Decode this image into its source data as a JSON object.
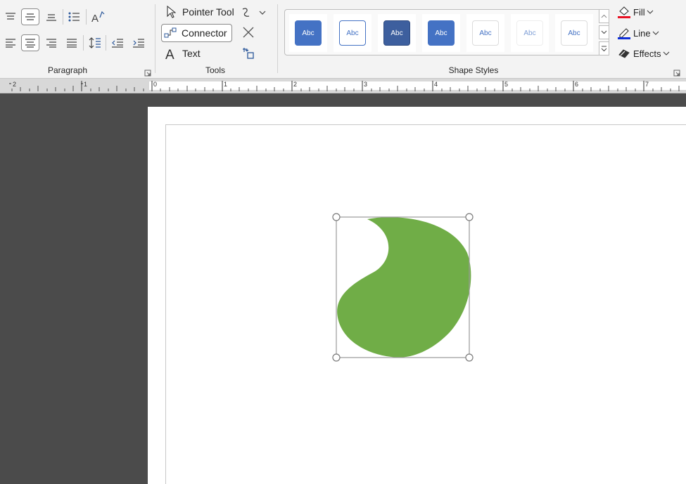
{
  "ribbon": {
    "paragraph_label": "Paragraph",
    "tools_label": "Tools",
    "shape_styles_label": "Shape Styles",
    "tools": {
      "pointer_tool": "Pointer Tool",
      "connector": "Connector",
      "text": "Text"
    },
    "styles": [
      {
        "label": "Abc"
      },
      {
        "label": "Abc"
      },
      {
        "label": "Abc"
      },
      {
        "label": "Abc"
      },
      {
        "label": "Abc"
      },
      {
        "label": "Abc"
      },
      {
        "label": "Abc"
      }
    ],
    "format": {
      "fill": "Fill",
      "line": "Line",
      "effects": "Effects"
    }
  },
  "ruler": {
    "numbers": [
      "2",
      "1",
      "0",
      "1",
      "2",
      "3",
      "4",
      "5",
      "6",
      "7"
    ]
  },
  "colors": {
    "shape_fill": "#70ad47",
    "accent_blue": "#4472c4",
    "dark_blue": "#3d5f9e",
    "fill_red": "#e81123",
    "line_blue": "#0f2fd8"
  }
}
